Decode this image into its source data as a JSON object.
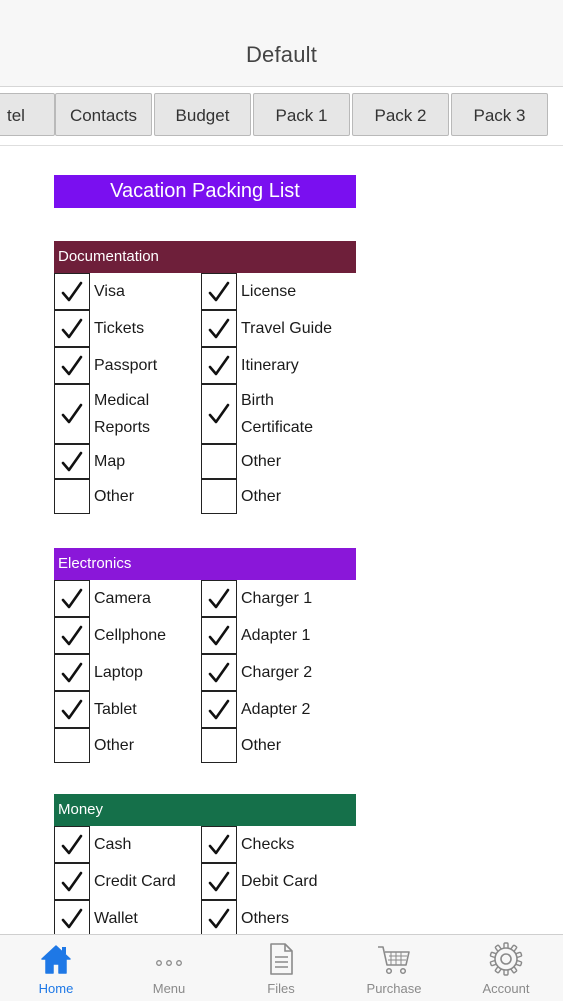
{
  "header": {
    "title": "Default"
  },
  "tabs": [
    {
      "label": "tel",
      "partial": true
    },
    {
      "label": "Contacts"
    },
    {
      "label": "Budget"
    },
    {
      "label": "Pack 1"
    },
    {
      "label": "Pack 2"
    },
    {
      "label": "Pack 3"
    }
  ],
  "page_title": "Vacation Packing List",
  "colors": {
    "title_bg": "#7a0ff0",
    "documentation": "#6e1f3a",
    "electronics": "#8a17d9",
    "money": "#15704a",
    "active_nav": "#1e78e6"
  },
  "sections": [
    {
      "id": "documentation",
      "title": "Documentation",
      "rows": [
        [
          {
            "label": "Visa",
            "checked": true
          },
          {
            "label": "License",
            "checked": true
          }
        ],
        [
          {
            "label": "Tickets",
            "checked": true
          },
          {
            "label": "Travel Guide",
            "checked": true
          }
        ],
        [
          {
            "label": "Passport",
            "checked": true
          },
          {
            "label": "Itinerary",
            "checked": true
          }
        ],
        [
          {
            "label": "Medical Reports",
            "checked": true
          },
          {
            "label": "Birth Certificate",
            "checked": true
          }
        ],
        [
          {
            "label": "Map",
            "checked": true
          },
          {
            "label": "Other",
            "checked": false
          }
        ],
        [
          {
            "label": "Other",
            "checked": false
          },
          {
            "label": "Other",
            "checked": false
          }
        ]
      ]
    },
    {
      "id": "electronics",
      "title": "Electronics",
      "rows": [
        [
          {
            "label": "Camera",
            "checked": true
          },
          {
            "label": "Charger 1",
            "checked": true
          }
        ],
        [
          {
            "label": "Cellphone",
            "checked": true
          },
          {
            "label": "Adapter 1",
            "checked": true
          }
        ],
        [
          {
            "label": "Laptop",
            "checked": true
          },
          {
            "label": "Charger 2",
            "checked": true
          }
        ],
        [
          {
            "label": "Tablet",
            "checked": true
          },
          {
            "label": "Adapter 2",
            "checked": true
          }
        ],
        [
          {
            "label": "Other",
            "checked": false
          },
          {
            "label": "Other",
            "checked": false
          }
        ]
      ]
    },
    {
      "id": "money",
      "title": "Money",
      "rows": [
        [
          {
            "label": "Cash",
            "checked": true
          },
          {
            "label": "Checks",
            "checked": true
          }
        ],
        [
          {
            "label": "Credit Card",
            "checked": true
          },
          {
            "label": "Debit Card",
            "checked": true
          }
        ],
        [
          {
            "label": "Wallet",
            "checked": true
          },
          {
            "label": "Others",
            "checked": true
          }
        ]
      ]
    }
  ],
  "bottom_nav": [
    {
      "label": "Home",
      "icon": "home-icon",
      "active": true
    },
    {
      "label": "Menu",
      "icon": "more-icon",
      "active": false
    },
    {
      "label": "Files",
      "icon": "file-icon",
      "active": false
    },
    {
      "label": "Purchase",
      "icon": "cart-icon",
      "active": false
    },
    {
      "label": "Account",
      "icon": "gear-icon",
      "active": false
    }
  ]
}
